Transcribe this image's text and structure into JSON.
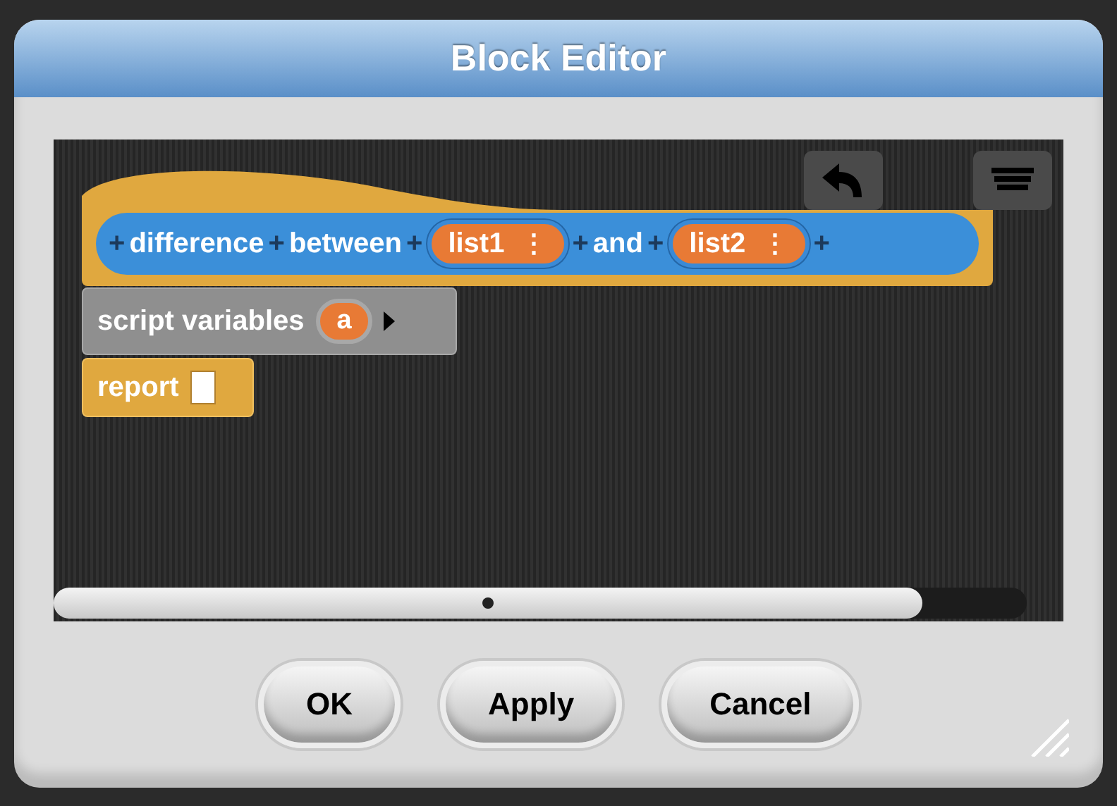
{
  "window": {
    "title": "Block Editor"
  },
  "definition": {
    "parts": [
      {
        "kind": "plus",
        "text": "+"
      },
      {
        "kind": "label",
        "text": "difference"
      },
      {
        "kind": "plus",
        "text": "+"
      },
      {
        "kind": "label",
        "text": "between"
      },
      {
        "kind": "plus",
        "text": "+"
      },
      {
        "kind": "input",
        "text": "list1",
        "menu": "⋮"
      },
      {
        "kind": "plus",
        "text": "+"
      },
      {
        "kind": "label",
        "text": "and"
      },
      {
        "kind": "plus",
        "text": "+"
      },
      {
        "kind": "input",
        "text": "list2",
        "menu": "⋮"
      },
      {
        "kind": "plus",
        "text": "+"
      }
    ]
  },
  "script": [
    {
      "kind": "script_variables",
      "label": "script variables",
      "variables": [
        "a"
      ]
    },
    {
      "kind": "report",
      "label": "report"
    }
  ],
  "buttons": [
    "OK",
    "Apply",
    "Cancel"
  ]
}
